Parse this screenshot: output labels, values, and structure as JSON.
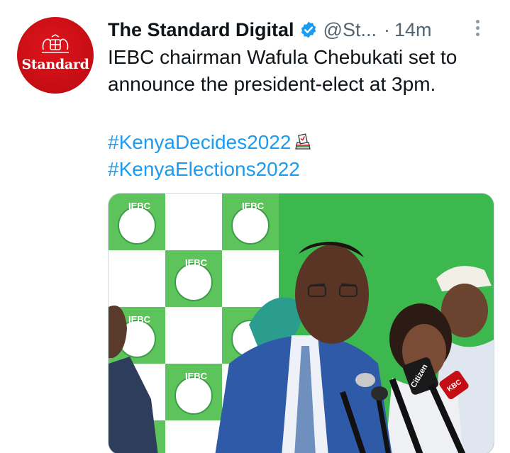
{
  "author": {
    "display_name": "The Standard Digital",
    "handle": "@St...",
    "verified": true,
    "avatar_text": "Standard",
    "avatar_color": "#d0111a"
  },
  "meta": {
    "separator": "·",
    "timestamp": "14m"
  },
  "tweet": {
    "line1": "IEBC chairman Wafula Chebukati set to",
    "line2": "announce the president-elect  at 3pm.",
    "hashtags": [
      "#KenyaDecides2022",
      "#KenyaElections2022"
    ],
    "emoji_icon": "ballot-box-icon"
  },
  "media": {
    "backdrop_text": "IEBC",
    "mic_label": "Citizen",
    "mic_label_2": "KBC"
  },
  "colors": {
    "link": "#1d9bf0",
    "secondary_text": "#536471",
    "verified": "#1d9bf0",
    "backdrop_green": "#35b54a"
  }
}
